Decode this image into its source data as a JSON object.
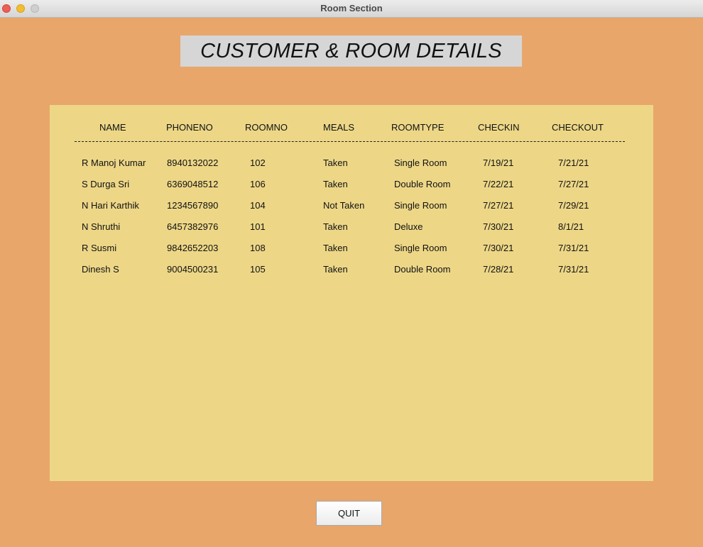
{
  "window": {
    "title": "Room Section"
  },
  "heading": "CUSTOMER & ROOM DETAILS",
  "table": {
    "columns": [
      "NAME",
      "PHONENO",
      "ROOMNO",
      "MEALS",
      "ROOMTYPE",
      "CHECKIN",
      "CHECKOUT"
    ],
    "rows": [
      [
        "R Manoj Kumar",
        "8940132022",
        "102",
        "Taken",
        "Single Room",
        "7/19/21",
        "7/21/21"
      ],
      [
        "S Durga Sri",
        "6369048512",
        "106",
        "Taken",
        "Double Room",
        "7/22/21",
        "7/27/21"
      ],
      [
        "N Hari Karthik",
        "1234567890",
        "104",
        "Not Taken",
        "Single Room",
        "7/27/21",
        "7/29/21"
      ],
      [
        "N Shruthi",
        "6457382976",
        "101",
        "Taken",
        "Deluxe",
        "7/30/21",
        "8/1/21"
      ],
      [
        "R Susmi",
        "9842652203",
        "108",
        "Taken",
        "Single Room",
        "7/30/21",
        "7/31/21"
      ],
      [
        "Dinesh S",
        "9004500231",
        "105",
        "Taken",
        "Double Room",
        "7/28/21",
        "7/31/21"
      ]
    ]
  },
  "buttons": {
    "quit": "QUIT"
  }
}
